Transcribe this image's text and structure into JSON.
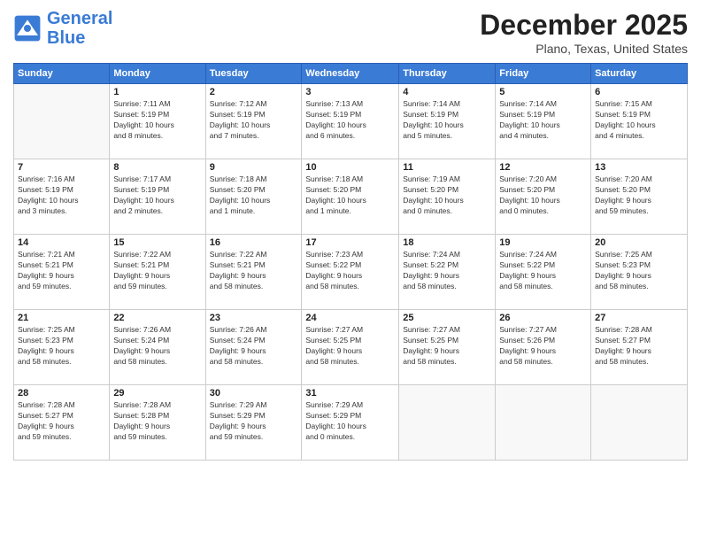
{
  "header": {
    "logo_line1": "General",
    "logo_line2": "Blue",
    "month": "December 2025",
    "location": "Plano, Texas, United States"
  },
  "days_of_week": [
    "Sunday",
    "Monday",
    "Tuesday",
    "Wednesday",
    "Thursday",
    "Friday",
    "Saturday"
  ],
  "weeks": [
    [
      {
        "day": "",
        "info": ""
      },
      {
        "day": "1",
        "info": "Sunrise: 7:11 AM\nSunset: 5:19 PM\nDaylight: 10 hours\nand 8 minutes."
      },
      {
        "day": "2",
        "info": "Sunrise: 7:12 AM\nSunset: 5:19 PM\nDaylight: 10 hours\nand 7 minutes."
      },
      {
        "day": "3",
        "info": "Sunrise: 7:13 AM\nSunset: 5:19 PM\nDaylight: 10 hours\nand 6 minutes."
      },
      {
        "day": "4",
        "info": "Sunrise: 7:14 AM\nSunset: 5:19 PM\nDaylight: 10 hours\nand 5 minutes."
      },
      {
        "day": "5",
        "info": "Sunrise: 7:14 AM\nSunset: 5:19 PM\nDaylight: 10 hours\nand 4 minutes."
      },
      {
        "day": "6",
        "info": "Sunrise: 7:15 AM\nSunset: 5:19 PM\nDaylight: 10 hours\nand 4 minutes."
      }
    ],
    [
      {
        "day": "7",
        "info": "Sunrise: 7:16 AM\nSunset: 5:19 PM\nDaylight: 10 hours\nand 3 minutes."
      },
      {
        "day": "8",
        "info": "Sunrise: 7:17 AM\nSunset: 5:19 PM\nDaylight: 10 hours\nand 2 minutes."
      },
      {
        "day": "9",
        "info": "Sunrise: 7:18 AM\nSunset: 5:20 PM\nDaylight: 10 hours\nand 1 minute."
      },
      {
        "day": "10",
        "info": "Sunrise: 7:18 AM\nSunset: 5:20 PM\nDaylight: 10 hours\nand 1 minute."
      },
      {
        "day": "11",
        "info": "Sunrise: 7:19 AM\nSunset: 5:20 PM\nDaylight: 10 hours\nand 0 minutes."
      },
      {
        "day": "12",
        "info": "Sunrise: 7:20 AM\nSunset: 5:20 PM\nDaylight: 10 hours\nand 0 minutes."
      },
      {
        "day": "13",
        "info": "Sunrise: 7:20 AM\nSunset: 5:20 PM\nDaylight: 9 hours\nand 59 minutes."
      }
    ],
    [
      {
        "day": "14",
        "info": "Sunrise: 7:21 AM\nSunset: 5:21 PM\nDaylight: 9 hours\nand 59 minutes."
      },
      {
        "day": "15",
        "info": "Sunrise: 7:22 AM\nSunset: 5:21 PM\nDaylight: 9 hours\nand 59 minutes."
      },
      {
        "day": "16",
        "info": "Sunrise: 7:22 AM\nSunset: 5:21 PM\nDaylight: 9 hours\nand 58 minutes."
      },
      {
        "day": "17",
        "info": "Sunrise: 7:23 AM\nSunset: 5:22 PM\nDaylight: 9 hours\nand 58 minutes."
      },
      {
        "day": "18",
        "info": "Sunrise: 7:24 AM\nSunset: 5:22 PM\nDaylight: 9 hours\nand 58 minutes."
      },
      {
        "day": "19",
        "info": "Sunrise: 7:24 AM\nSunset: 5:22 PM\nDaylight: 9 hours\nand 58 minutes."
      },
      {
        "day": "20",
        "info": "Sunrise: 7:25 AM\nSunset: 5:23 PM\nDaylight: 9 hours\nand 58 minutes."
      }
    ],
    [
      {
        "day": "21",
        "info": "Sunrise: 7:25 AM\nSunset: 5:23 PM\nDaylight: 9 hours\nand 58 minutes."
      },
      {
        "day": "22",
        "info": "Sunrise: 7:26 AM\nSunset: 5:24 PM\nDaylight: 9 hours\nand 58 minutes."
      },
      {
        "day": "23",
        "info": "Sunrise: 7:26 AM\nSunset: 5:24 PM\nDaylight: 9 hours\nand 58 minutes."
      },
      {
        "day": "24",
        "info": "Sunrise: 7:27 AM\nSunset: 5:25 PM\nDaylight: 9 hours\nand 58 minutes."
      },
      {
        "day": "25",
        "info": "Sunrise: 7:27 AM\nSunset: 5:25 PM\nDaylight: 9 hours\nand 58 minutes."
      },
      {
        "day": "26",
        "info": "Sunrise: 7:27 AM\nSunset: 5:26 PM\nDaylight: 9 hours\nand 58 minutes."
      },
      {
        "day": "27",
        "info": "Sunrise: 7:28 AM\nSunset: 5:27 PM\nDaylight: 9 hours\nand 58 minutes."
      }
    ],
    [
      {
        "day": "28",
        "info": "Sunrise: 7:28 AM\nSunset: 5:27 PM\nDaylight: 9 hours\nand 59 minutes."
      },
      {
        "day": "29",
        "info": "Sunrise: 7:28 AM\nSunset: 5:28 PM\nDaylight: 9 hours\nand 59 minutes."
      },
      {
        "day": "30",
        "info": "Sunrise: 7:29 AM\nSunset: 5:29 PM\nDaylight: 9 hours\nand 59 minutes."
      },
      {
        "day": "31",
        "info": "Sunrise: 7:29 AM\nSunset: 5:29 PM\nDaylight: 10 hours\nand 0 minutes."
      },
      {
        "day": "",
        "info": ""
      },
      {
        "day": "",
        "info": ""
      },
      {
        "day": "",
        "info": ""
      }
    ]
  ]
}
